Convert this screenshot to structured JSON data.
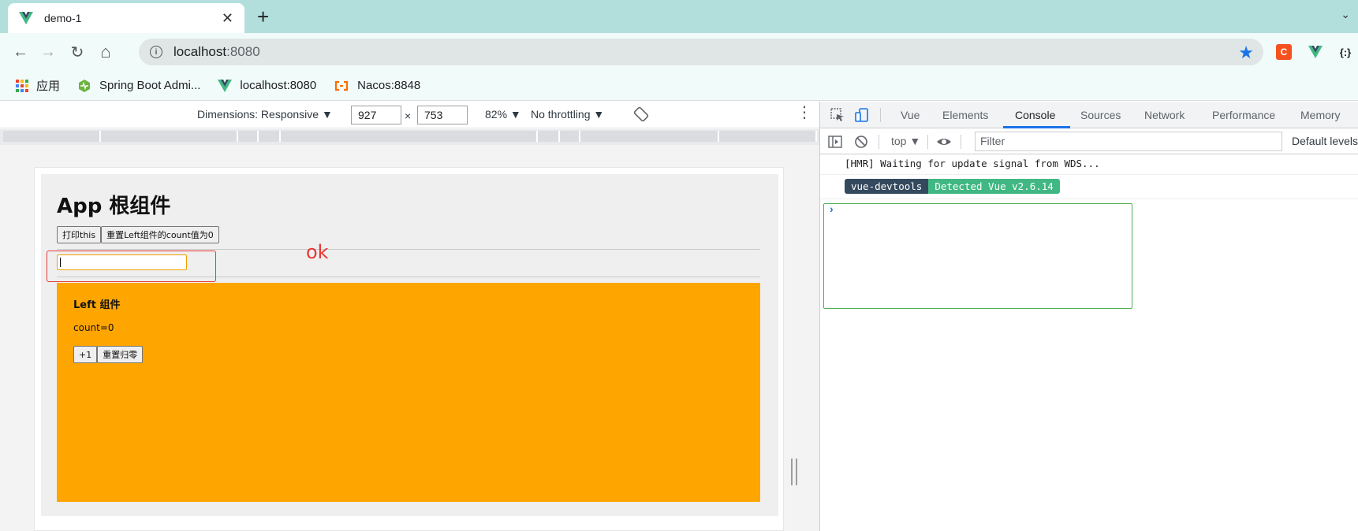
{
  "tab": {
    "title": "demo-1",
    "close": "✕",
    "new_tab": "+",
    "menu": "⌄"
  },
  "toolbar": {
    "back": "←",
    "forward": "→",
    "reload": "↻",
    "home": "⌂",
    "url_host": "localhost",
    "url_port": ":8080",
    "star": "★",
    "ext_c": "C",
    "ext_json": "{:}"
  },
  "bookmarks": [
    {
      "label": "应用",
      "icon": "apps-grid-icon"
    },
    {
      "label": "Spring Boot Admi...",
      "icon": "spring-boot-admin-icon"
    },
    {
      "label": "localhost:8080",
      "icon": "vue-logo-icon"
    },
    {
      "label": "Nacos:8848",
      "icon": "nacos-icon"
    }
  ],
  "device_toolbar": {
    "dimensions": "Dimensions: Responsive ▼",
    "width": "927",
    "times": "×",
    "height": "753",
    "zoom": "82% ▼",
    "throttling": "No throttling ▼",
    "more": "⋮"
  },
  "app": {
    "heading": "App 根组件",
    "btn_print": "打印this",
    "btn_reset": "重置Left组件的count值为0",
    "annotation": "ok",
    "left": {
      "heading": "Left 组件",
      "count": "count=0",
      "btn_plus": "+1",
      "btn_reset": "重置归零"
    }
  },
  "devtools": {
    "tabs": [
      "Vue",
      "Elements",
      "Console",
      "Sources",
      "Network",
      "Performance",
      "Memory"
    ],
    "active_tab": "Console",
    "context": "top ▼",
    "filter_placeholder": "Filter",
    "levels": "Default levels",
    "messages": {
      "hmr": "[HMR] Waiting for update signal from WDS...",
      "badge_left": "vue-devtools",
      "badge_right": "Detected Vue v2.6.14"
    },
    "prompt": "›"
  },
  "colors": {
    "tabstrip": "#b2dfdc",
    "accent": "#1a73e8",
    "left_bg": "#ffa500",
    "vue_dark": "#35495e",
    "vue_green": "#41b883",
    "annotation_red": "#e53935"
  }
}
